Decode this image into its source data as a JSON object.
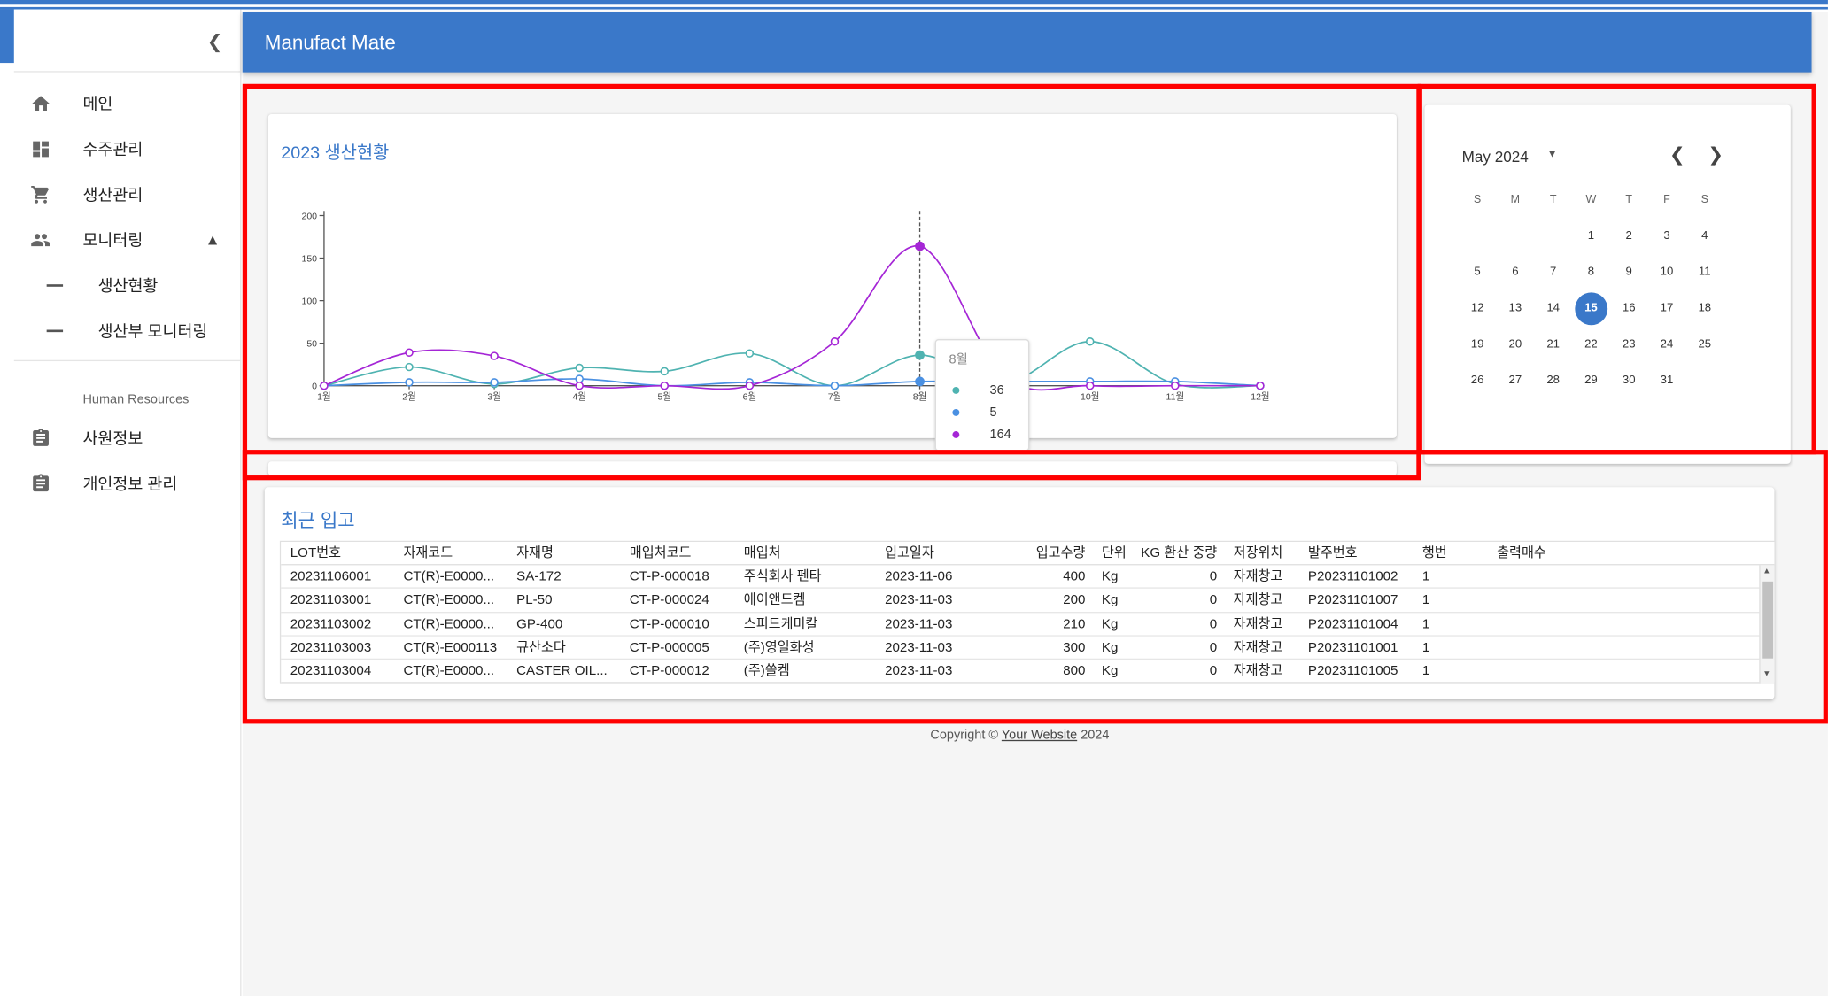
{
  "app": {
    "title": "Manufact Mate"
  },
  "sidebar": {
    "items": [
      {
        "label": "메인",
        "icon": "home-icon"
      },
      {
        "label": "수주관리",
        "icon": "dashboard-icon"
      },
      {
        "label": "생산관리",
        "icon": "cart-icon"
      },
      {
        "label": "모니터링",
        "icon": "people-icon"
      }
    ],
    "subitems": [
      {
        "label": "생산현황"
      },
      {
        "label": "생산부 모니터링"
      }
    ],
    "section_header": "Human Resources",
    "hr_items": [
      {
        "label": "사원정보",
        "icon": "clipboard-icon"
      },
      {
        "label": "개인정보 관리",
        "icon": "clipboard-icon"
      }
    ]
  },
  "production": {
    "title": "2023 생산현황"
  },
  "chart_data": {
    "type": "line",
    "title": "2023 생산현황",
    "categories": [
      "1월",
      "2월",
      "3월",
      "4월",
      "5월",
      "6월",
      "7월",
      "8월",
      "9월",
      "10월",
      "11월",
      "12월"
    ],
    "ylim": [
      0,
      200
    ],
    "yticks": [
      0,
      50,
      100,
      150,
      200
    ],
    "grid": false,
    "series": [
      {
        "color": "#4fb3b1",
        "values": [
          0,
          22,
          2,
          21,
          17,
          38,
          0,
          36,
          3,
          52,
          2,
          0
        ]
      },
      {
        "color": "#4a90e2",
        "values": [
          0,
          4,
          4,
          8,
          0,
          4,
          0,
          5,
          5,
          5,
          5,
          0
        ]
      },
      {
        "color": "#a526d6",
        "values": [
          0,
          39,
          35,
          0,
          0,
          0,
          52,
          164,
          10,
          0,
          0,
          0
        ]
      }
    ],
    "tooltip": {
      "label": "8월",
      "values": [
        "36",
        "5",
        "164"
      ]
    }
  },
  "calendar": {
    "month_label": "May 2024",
    "weekdays": [
      "S",
      "M",
      "T",
      "W",
      "T",
      "F",
      "S"
    ],
    "weeks": [
      [
        "",
        "",
        "",
        "1",
        "2",
        "3",
        "4"
      ],
      [
        "5",
        "6",
        "7",
        "8",
        "9",
        "10",
        "11"
      ],
      [
        "12",
        "13",
        "14",
        "15",
        "16",
        "17",
        "18"
      ],
      [
        "19",
        "20",
        "21",
        "22",
        "23",
        "24",
        "25"
      ],
      [
        "26",
        "27",
        "28",
        "29",
        "30",
        "31",
        ""
      ]
    ],
    "selected": "15"
  },
  "recent": {
    "title": "최근 입고",
    "columns": [
      "LOT번호",
      "자재코드",
      "자재명",
      "매입처코드",
      "매입처",
      "입고일자",
      "입고수량",
      "단위",
      "KG 환산 중량",
      "저장위치",
      "발주번호",
      "행번",
      "출력매수"
    ],
    "rows": [
      [
        "20231106001",
        "CT(R)-E0000...",
        "SA-172",
        "CT-P-000018",
        "주식회사 펜타",
        "2023-11-06",
        "400",
        "Kg",
        "0",
        "자재창고",
        "P20231101002",
        "1",
        ""
      ],
      [
        "20231103001",
        "CT(R)-E0000...",
        "PL-50",
        "CT-P-000024",
        "에이앤드켐",
        "2023-11-03",
        "200",
        "Kg",
        "0",
        "자재창고",
        "P20231101007",
        "1",
        ""
      ],
      [
        "20231103002",
        "CT(R)-E0000...",
        "GP-400",
        "CT-P-000010",
        "스피드케미칼",
        "2023-11-03",
        "210",
        "Kg",
        "0",
        "자재창고",
        "P20231101004",
        "1",
        ""
      ],
      [
        "20231103003",
        "CT(R)-E000113",
        "규산소다",
        "CT-P-000005",
        "(주)영일화성",
        "2023-11-03",
        "300",
        "Kg",
        "0",
        "자재창고",
        "P20231101001",
        "1",
        ""
      ],
      [
        "20231103004",
        "CT(R)-E0000...",
        "CASTER OIL...",
        "CT-P-000012",
        "(주)쏠켐",
        "2023-11-03",
        "800",
        "Kg",
        "0",
        "자재창고",
        "P20231101005",
        "1",
        ""
      ]
    ]
  },
  "footer": {
    "prefix": "Copyright © ",
    "link": "Your Website",
    "suffix": " 2024"
  }
}
